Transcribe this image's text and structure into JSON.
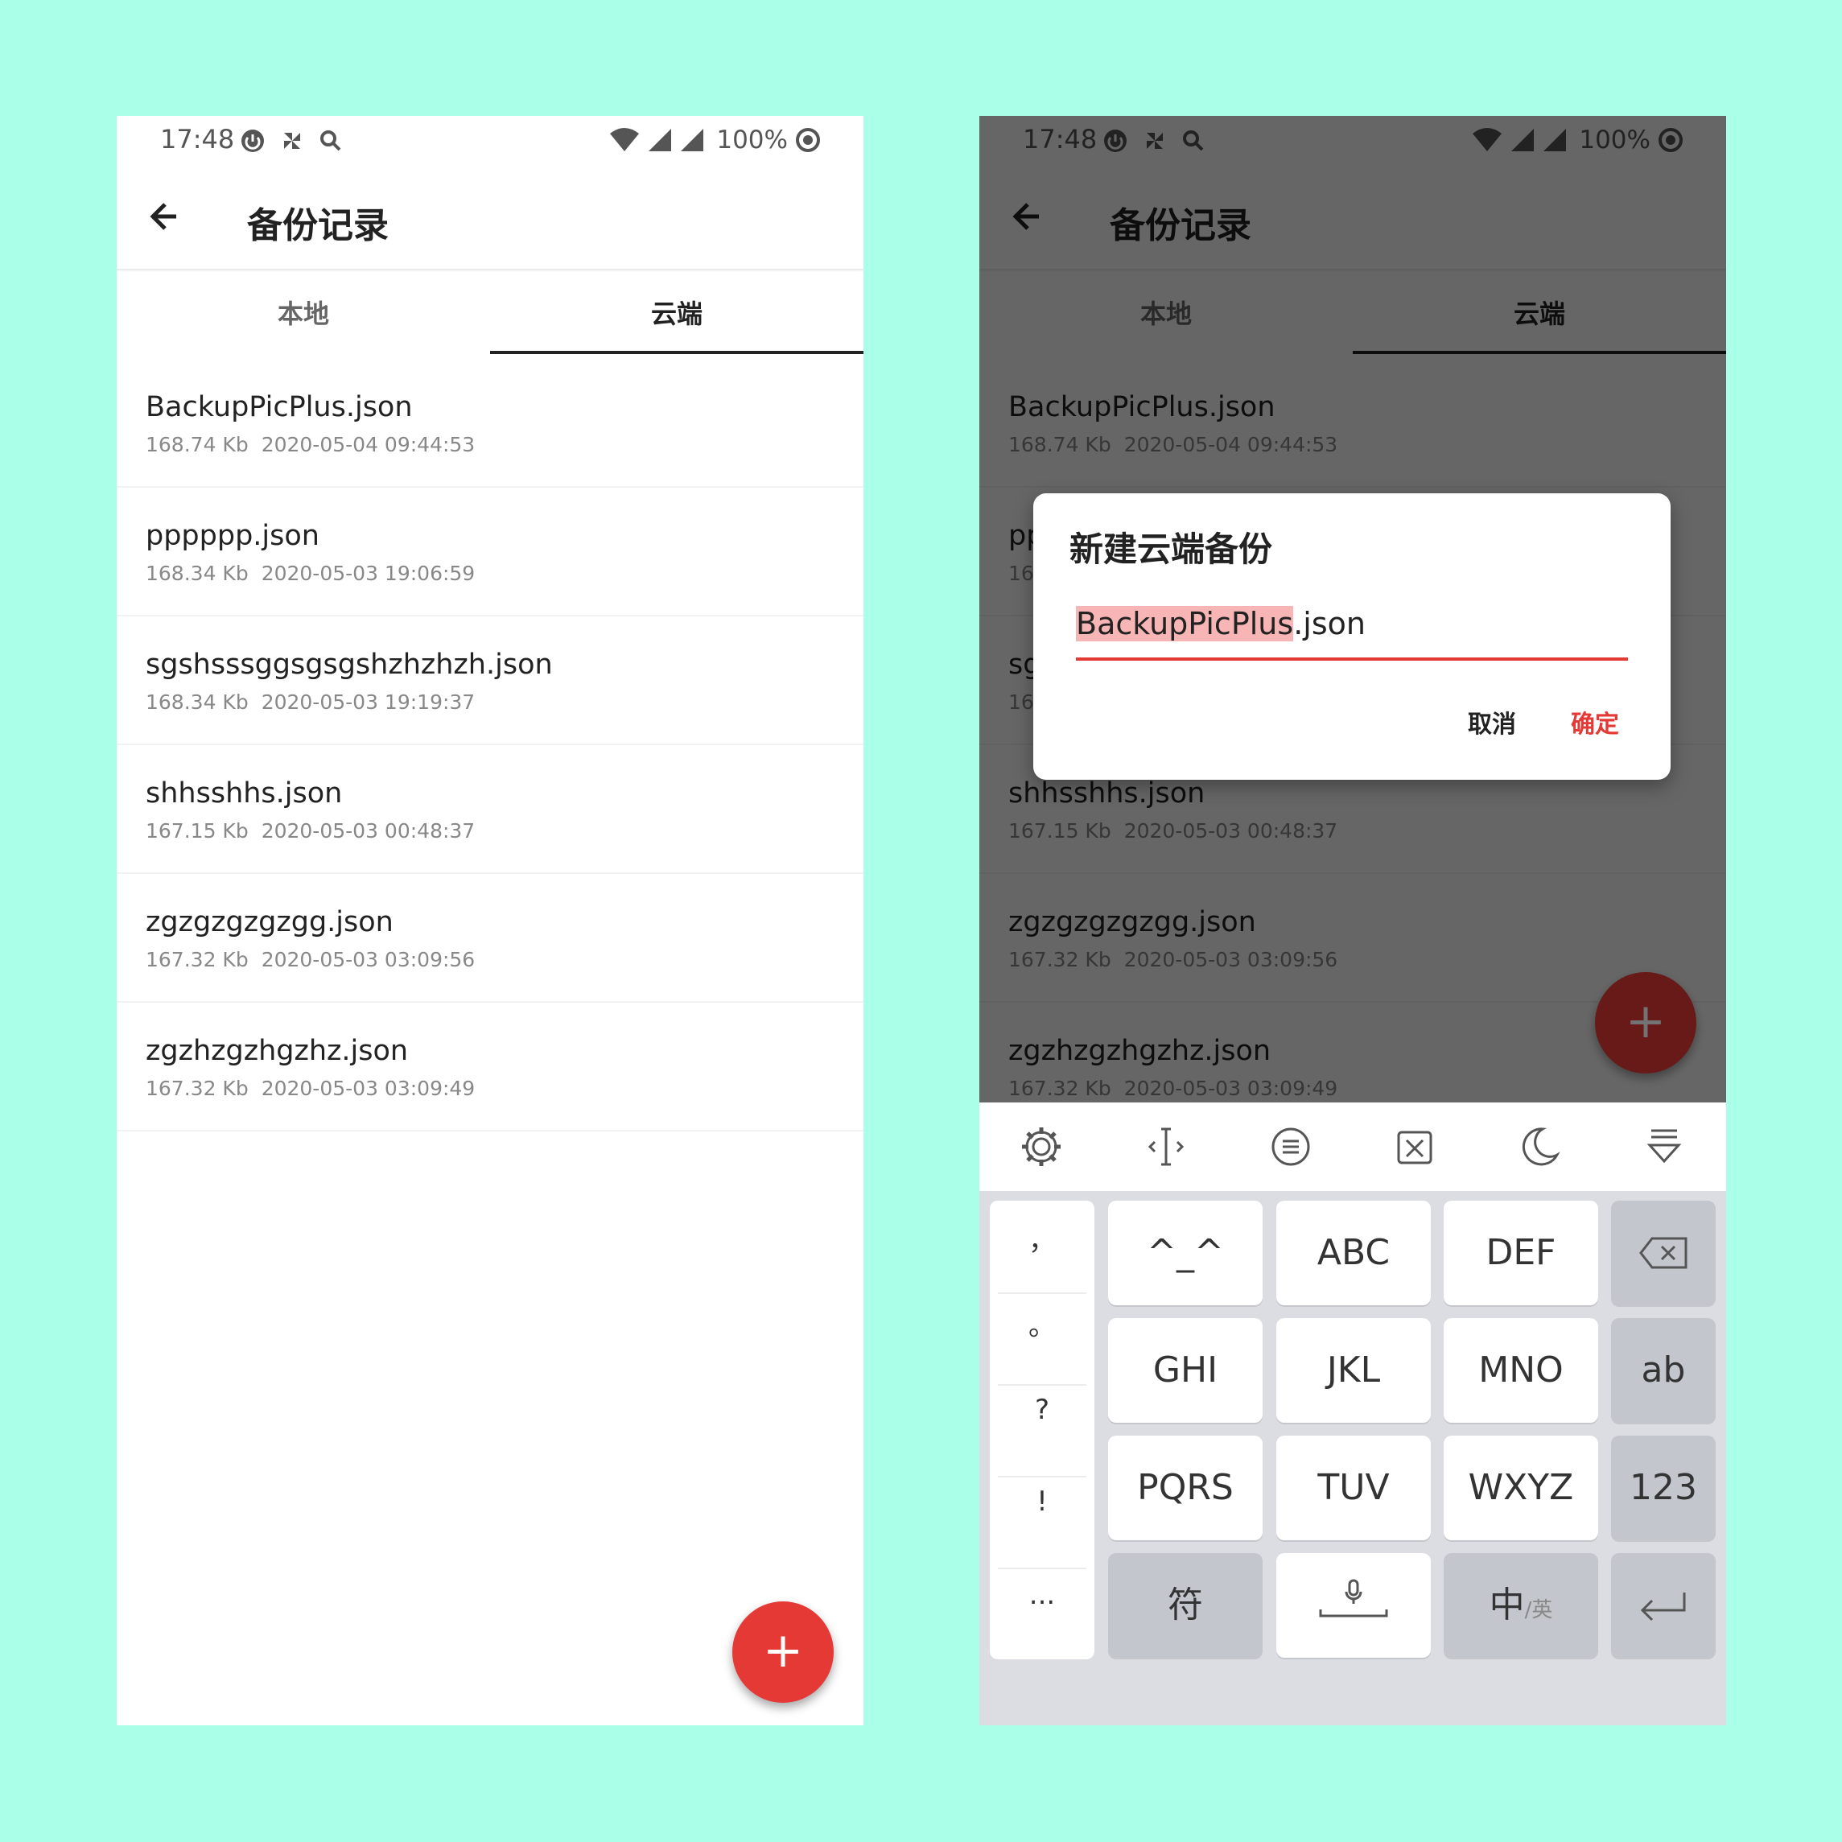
{
  "status_bar": {
    "time": "17:48",
    "battery": "100%"
  },
  "app_bar": {
    "title": "备份记录"
  },
  "tabs": [
    {
      "label": "本地"
    },
    {
      "label": "云端"
    }
  ],
  "files": [
    {
      "name": "BackupPicPlus.json",
      "size": "168.74 Kb",
      "date": "2020-05-04 09:44:53"
    },
    {
      "name": "pppppp.json",
      "size": "168.34 Kb",
      "date": "2020-05-03 19:06:59"
    },
    {
      "name": "sgshsssggsgsgshzhzhzh.json",
      "size": "168.34 Kb",
      "date": "2020-05-03 19:19:37"
    },
    {
      "name": "shhsshhs.json",
      "size": "167.15 Kb",
      "date": "2020-05-03 00:48:37"
    },
    {
      "name": "zgzgzgzgzgg.json",
      "size": "167.32 Kb",
      "date": "2020-05-03 03:09:56"
    },
    {
      "name": "zgzhzgzhgzhz.json",
      "size": "167.32 Kb",
      "date": "2020-05-03 03:09:49"
    }
  ],
  "fab": {
    "label": "+"
  },
  "dialog": {
    "title": "新建云端备份",
    "input_selected": "BackupPicPlus",
    "input_rest": ".json",
    "cancel_label": "取消",
    "ok_label": "确定"
  },
  "keyboard": {
    "toolbar_icons": [
      "gear-icon",
      "cursor-icon",
      "clipboard-icon",
      "scissors-icon",
      "moon-icon",
      "hide-keyboard-icon"
    ],
    "punctuation": [
      "，",
      "。",
      "?",
      "!",
      "..."
    ],
    "rows": [
      [
        "^_^",
        "ABC",
        "DEF"
      ],
      [
        "GHI",
        "JKL",
        "MNO"
      ],
      [
        "PQRS",
        "TUV",
        "WXYZ"
      ]
    ],
    "side_keys": [
      "ab",
      "123"
    ],
    "symbol_key": "符",
    "lang_key_main": "中",
    "lang_key_alt": "/英",
    "colors": {
      "accent": "#e53935",
      "background": "#aaffe9"
    }
  }
}
